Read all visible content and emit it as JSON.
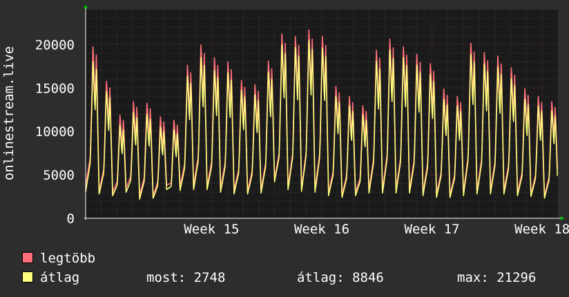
{
  "colors": {
    "background": "#2d2d2d",
    "plot_background": "#1a1a1a",
    "series_max": "#ff6f7a",
    "series_avg": "#ffff7f",
    "grid_minor": "#3c3c3c",
    "grid_major": "#6b2c30",
    "axis_arrow": "#00cc00",
    "text": "#ffffff"
  },
  "legend": {
    "items": [
      {
        "label": "legtöbb",
        "color": "#ff6f7a"
      },
      {
        "label": "átlag",
        "color": "#ffff7f"
      }
    ]
  },
  "stats": {
    "now_label": "most:",
    "now_value": "2748",
    "avg_label": "átlag:",
    "avg_value": "8846",
    "max_label": "max:",
    "max_value": "21296"
  },
  "chart_data": {
    "type": "line",
    "ylabel": "onlinestream.live",
    "ylim": [
      0,
      24000
    ],
    "yticks": [
      0,
      5000,
      10000,
      15000,
      20000
    ],
    "x_unit": "days",
    "xlim": [
      0,
      30
    ],
    "x_tick_labels": [
      {
        "label": "Week 15",
        "day": 8
      },
      {
        "label": "Week 16",
        "day": 15
      },
      {
        "label": "Week 17",
        "day": 22
      },
      {
        "label": "Week 18",
        "day": 29
      }
    ],
    "grid": true,
    "series": [
      {
        "name": "legtöbb",
        "daily_peaks": [
          20300,
          16200,
          12200,
          13800,
          13600,
          12000,
          11600,
          18100,
          20500,
          19000,
          18500,
          16300,
          15800,
          18600,
          21800,
          21500,
          22300,
          21500,
          15600,
          14400,
          13300,
          19900,
          21200,
          20300,
          19400,
          18300,
          15300,
          14400,
          20700,
          19600,
          19200,
          17800,
          15300,
          14400,
          13800
        ],
        "daily_mins": [
          3800,
          3200,
          3000,
          3500,
          2600,
          2600,
          3800,
          3700,
          3800,
          3700,
          3500,
          3200,
          3200,
          3300,
          4500,
          3700,
          3500,
          3400,
          3000,
          2700,
          3000,
          3300,
          3300,
          3300,
          3300,
          3000,
          2800,
          2700,
          3000,
          3200,
          3200,
          3200,
          3000,
          2800,
          2600
        ]
      },
      {
        "name": "átlag",
        "daily_peaks": [
          18500,
          15000,
          11000,
          12500,
          12300,
          10800,
          10500,
          16800,
          19000,
          17500,
          17200,
          15100,
          14600,
          17300,
          20500,
          20200,
          21000,
          20100,
          14400,
          13300,
          12200,
          18600,
          19900,
          19000,
          18100,
          17000,
          14100,
          13300,
          19400,
          18300,
          17900,
          16500,
          14100,
          13300,
          12700
        ],
        "daily_mins": [
          3000,
          2800,
          2600,
          3000,
          2200,
          2300,
          3300,
          3200,
          3300,
          3300,
          3000,
          2800,
          2800,
          2900,
          4200,
          3300,
          3100,
          3000,
          2600,
          2400,
          2600,
          2900,
          2900,
          2900,
          2900,
          2600,
          2400,
          2400,
          2600,
          2800,
          2800,
          2800,
          2600,
          2500,
          2300
        ]
      }
    ]
  }
}
